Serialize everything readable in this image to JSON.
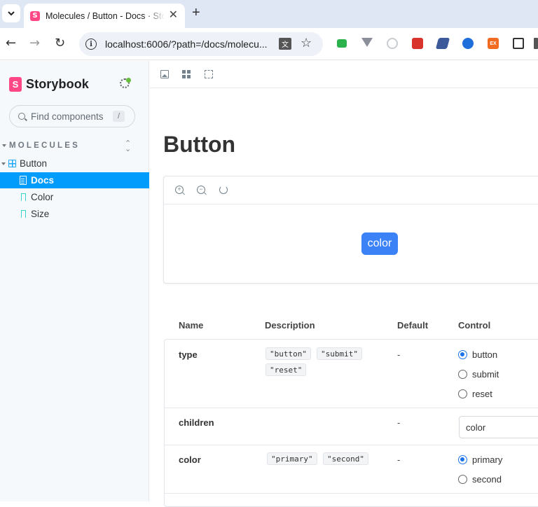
{
  "browser": {
    "tab_title": "Molecules / Button - Docs · Storybook",
    "tab_close": "✕",
    "new_tab": "+",
    "url": "localhost:6006/?path=/docs/molecu...",
    "back": "←",
    "forward": "→",
    "reload": "↻",
    "star": "☆",
    "extensions": [
      {
        "name": "green-ext-icon",
        "color": "#2bb24c"
      },
      {
        "name": "vue-ext-icon",
        "color": "#8a8f99"
      },
      {
        "name": "circle-ext-icon",
        "color": "#c9ccd1"
      },
      {
        "name": "bug-ext-icon",
        "color": "#d9342b"
      },
      {
        "name": "blue-ext-icon",
        "color": "#3c5a99"
      },
      {
        "name": "shield-ext-icon",
        "color": "#1e6fd9"
      },
      {
        "name": "ex-ext-icon",
        "color": "#f26b21"
      }
    ]
  },
  "sidebar": {
    "logo": "S",
    "brand": "Storybook",
    "search_placeholder": "Find components",
    "search_shortcut": "/",
    "section": "MOLECULES",
    "component": "Button",
    "items": [
      {
        "label": "Docs",
        "selected": true
      },
      {
        "label": "Color",
        "selected": false
      },
      {
        "label": "Size",
        "selected": false
      }
    ]
  },
  "main": {
    "title": "Button",
    "preview_button": "color",
    "table": {
      "headers": [
        "Name",
        "Description",
        "Default",
        "Control"
      ],
      "rows": [
        {
          "name": "type",
          "options": [
            "\"button\"",
            "\"submit\"",
            "\"reset\""
          ],
          "default": "-",
          "control": [
            "button",
            "submit",
            "reset"
          ],
          "selected": "button"
        },
        {
          "name": "children",
          "default": "-",
          "value": "color"
        },
        {
          "name": "color",
          "options": [
            "\"primary\"",
            "\"second\""
          ],
          "default": "-",
          "control": [
            "primary",
            "second"
          ],
          "selected": "primary"
        }
      ]
    }
  },
  "colors": {
    "accent": "#029cfd",
    "brand": "#ff4785",
    "button": "#3b82f6"
  }
}
